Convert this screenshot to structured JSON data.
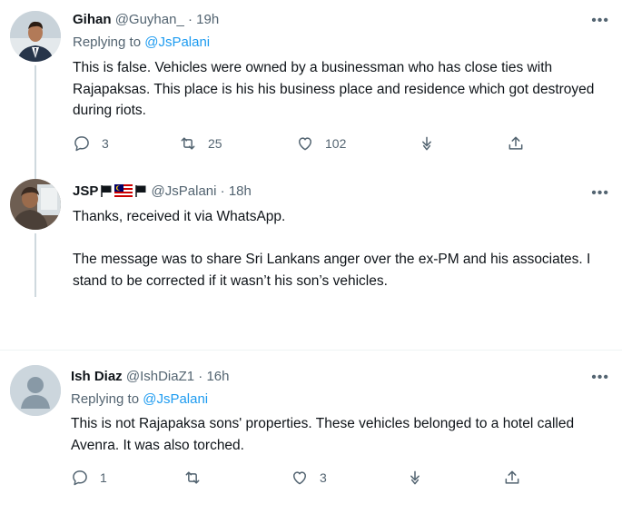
{
  "tweets": [
    {
      "name": "Gihan",
      "handle": "@Guyhan_",
      "separator": "·",
      "time": "19h",
      "replying_prefix": "Replying to",
      "replying_to": "@JsPalani",
      "text": "This is false. Vehicles were owned by a businessman who has close ties with Rajapaksas. This place is his his business place and residence which got destroyed during riots.",
      "replies": "3",
      "retweets": "25",
      "likes": "102"
    },
    {
      "name": "JSP",
      "handle": "@JsPalani",
      "separator": "·",
      "time": "18h",
      "text": "Thanks, received it via WhatsApp.\n\nThe message was to share Sri Lankans anger over the ex-PM and his associates. I stand to be corrected if it wasn’t his son’s vehicles."
    },
    {
      "name": "Ish Diaz",
      "handle": "@IshDiaZ1",
      "separator": "·",
      "time": "16h",
      "replying_prefix": "Replying to",
      "replying_to": "@JsPalani",
      "text": "This is not Rajapaksa sons' properties. These vehicles belonged to a hotel called Avenra. It was also torched.",
      "replies": "1",
      "retweets": "",
      "likes": "3"
    }
  ],
  "more_label": "•••",
  "icons": {
    "reply": "reply-icon",
    "retweet": "retweet-icon",
    "like": "heart-icon",
    "download": "download-icon",
    "share": "share-icon"
  },
  "colors": {
    "link": "#1d9bf0",
    "secondary_text": "#536471",
    "thread_line": "#cfd9de"
  }
}
